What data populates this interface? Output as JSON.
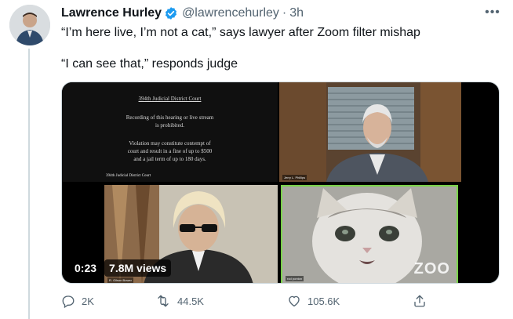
{
  "tweet": {
    "author_name": "Lawrence Hurley",
    "handle": "@lawrencehurley",
    "separator": "·",
    "time": "3h",
    "more_label": "•••",
    "text_line1": "“I’m here live, I’m not a cat,” says lawyer after Zoom filter mishap",
    "text_line2": "“I can see that,” responds judge"
  },
  "media": {
    "notice": {
      "title": "394th Judicial District Court",
      "lines": [
        "Recording of this hearing or live stream",
        "is prohibited.",
        "Violation may constitute contempt of",
        "court and result in a fine of up to $500",
        "and a jail term of up to 180 days."
      ],
      "footer": "394th Judicial District Court"
    },
    "judge_tag": "Jerry L. Phillips",
    "lawyer_tag": "R. Gilson Bower",
    "cat_tag": "rod ponton",
    "watermark": "ZOO",
    "duration": "0:23",
    "views": "7.8M views"
  },
  "actions": {
    "replies": "2K",
    "retweets": "44.5K",
    "likes": "105.6K"
  },
  "colors": {
    "verified": "#1d9bf0",
    "secondary_text": "#536471",
    "cat_border": "#7ad34a"
  },
  "icons": [
    "verified-badge-icon",
    "more-icon",
    "reply-icon",
    "retweet-icon",
    "like-icon",
    "share-icon"
  ]
}
